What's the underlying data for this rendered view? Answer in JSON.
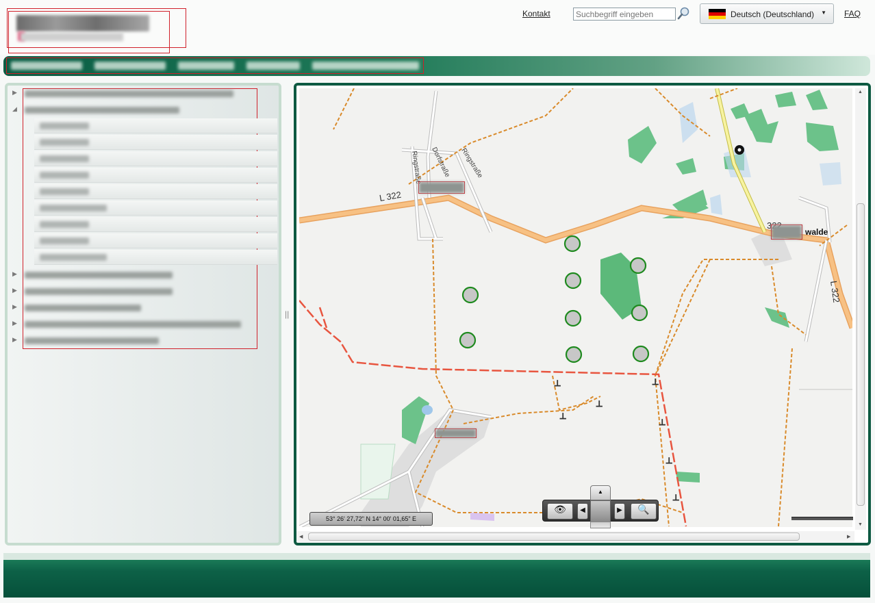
{
  "header": {
    "kontakt": "Kontakt",
    "search_placeholder": "Suchbegriff eingeben",
    "language": "Deutsch (Deutschland)",
    "faq": "FAQ"
  },
  "nav": {
    "items": [
      "",
      "",
      "",
      "",
      ""
    ]
  },
  "map": {
    "coordinates": "53° 26' 27,72\" N 14° 00' 01,65\" E",
    "road_label_1": "L 322",
    "road_label_2": "322",
    "road_label_3": "L 322",
    "street_1": "Dorfstraße",
    "street_2": "Ringstraße",
    "street_3": "Ringstraße",
    "village_suffix": "walde"
  },
  "colors": {
    "primary_green": "#0e5a42",
    "road_orange": "#f4b06c",
    "boundary_red": "#e8553f",
    "path_orange": "#d98a2a",
    "turbine_marker": "#1e8a1e",
    "forest": "#6cc28a"
  }
}
